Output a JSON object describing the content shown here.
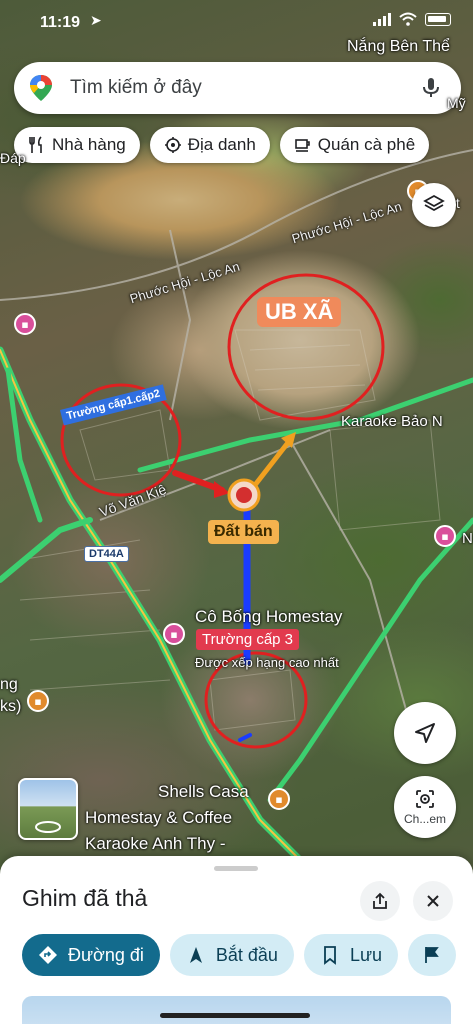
{
  "status": {
    "time": "11:19"
  },
  "search": {
    "placeholder": "Tìm kiếm ở đây"
  },
  "chips": [
    {
      "label": "Nhà hàng",
      "icon": "fork-knife-icon"
    },
    {
      "label": "Địa danh",
      "icon": "landmark-icon"
    },
    {
      "label": "Quán cà phê",
      "icon": "coffee-cup-icon"
    }
  ],
  "map": {
    "labels": {
      "top_right": "Nắng Bên Thể",
      "road_1": "Phước Hội - Lộc An",
      "road_2": "Phước Hội - Lộc An",
      "karaoke": "Karaoke Bảo N",
      "vo_van_kiet": "Võ Văn Kiệ",
      "route": "DT44A",
      "homestay": "Cô Bống Homestay",
      "ranked": "Được xếp hạng cao nhất",
      "shells_1": "Shells Casa",
      "shells_2": "Homestay & Coffee",
      "karaoke_thy": "Karaoke Anh Thy -",
      "edge_dap": "Đáp",
      "edge_ng": "ng",
      "edge_ks": "ks)",
      "edge_n": "N",
      "edge_viet": "iệt",
      "edge_my": "Mỹ"
    },
    "annotations": {
      "ub_xa": "UB XÃ",
      "dat_ban": "Đất bán",
      "truong_cap12": "Trường cấp1.cấp2",
      "truong_cap3": "Trường cấp 3"
    },
    "lens_label": "Ch...em"
  },
  "sheet": {
    "title": "Ghim đã thả",
    "actions": [
      {
        "label": "Đường đi",
        "icon": "directions-icon"
      },
      {
        "label": "Bắt đầu",
        "icon": "navigation-arrow-icon"
      },
      {
        "label": "Lưu",
        "icon": "bookmark-icon"
      }
    ]
  },
  "colors": {
    "traffic_green": "#3cd070",
    "road_yellow": "#f5c542",
    "annotation_red": "#e02020",
    "route_blue": "#1a3cff",
    "route_orange": "#f0a020",
    "primary_button": "#136b8d",
    "secondary_button": "#d3ecf5"
  }
}
